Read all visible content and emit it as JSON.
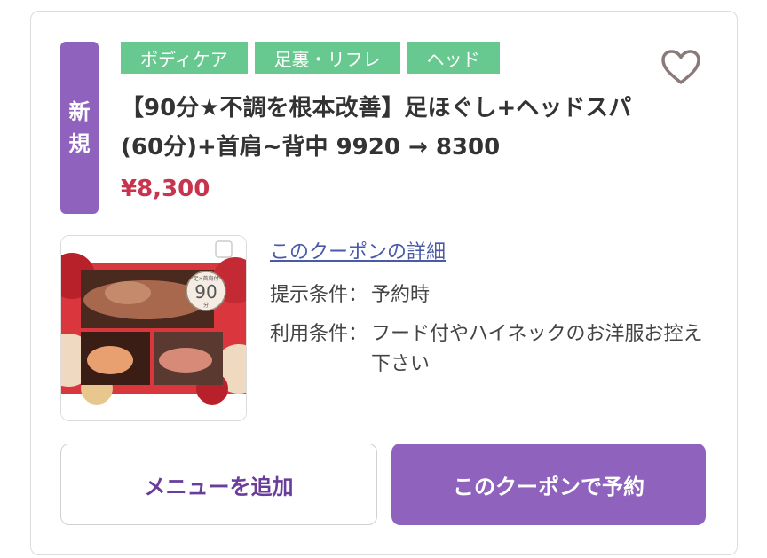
{
  "badge": {
    "line1": "新",
    "line2": "規"
  },
  "tags": [
    "ボディケア",
    "足裏・リフレ",
    "ヘッド"
  ],
  "favorite_icon": "heart-outline-icon",
  "coupon": {
    "title": "【90分★不調を根本改善】足ほぐし+ヘッドスパ(60分)+首肩~背中 9920 → 8300",
    "price": "¥8,300",
    "details_link": "このクーポンの詳細",
    "conditions": [
      {
        "label": "提示条件：",
        "value": "予約時"
      },
      {
        "label": "利用条件：",
        "value": "フード付やハイネックのお洋服お控え下さい"
      }
    ]
  },
  "thumbnail": {
    "badge_top": "足×首肩付",
    "badge_num": "90",
    "badge_unit": "分"
  },
  "buttons": {
    "add_menu": "メニューを追加",
    "reserve": "このクーポンで予約"
  },
  "colors": {
    "accent": "#8f63bd",
    "tag": "#67c98f",
    "price": "#c8344e",
    "link": "#4a5aa8"
  }
}
